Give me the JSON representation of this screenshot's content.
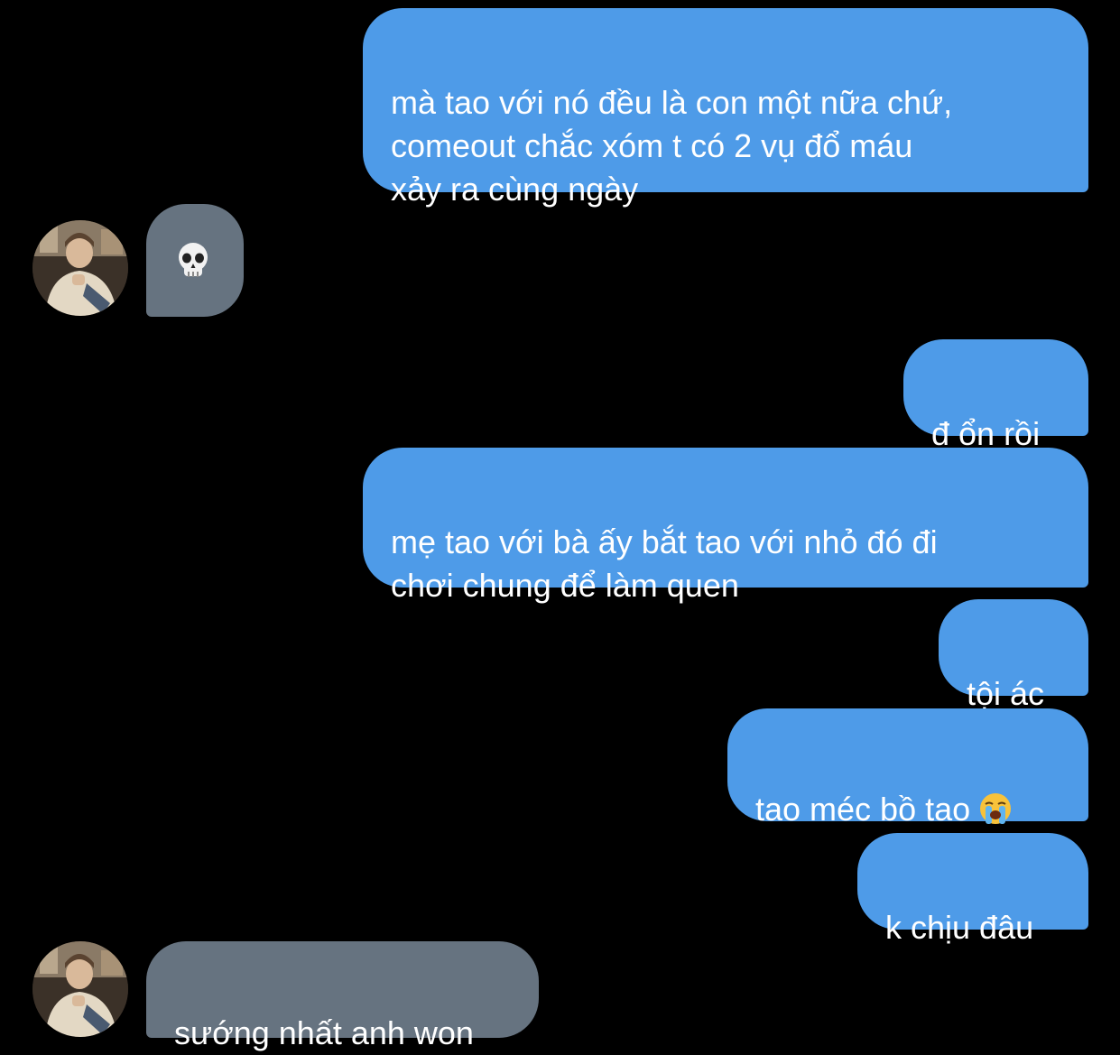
{
  "conversation": {
    "messages": [
      {
        "sender": "me",
        "text": "mà tao với nó đều là con một nữa chứ,\ncomeout chắc xóm t có 2 vụ đổ máu\nxảy ra cùng ngày"
      },
      {
        "sender": "them",
        "emoji": "skull-emoji"
      },
      {
        "sender": "me",
        "text": "đ ổn rồi"
      },
      {
        "sender": "me",
        "text": "mẹ tao với bà ấy bắt tao với nhỏ đó đi\nchơi chung để làm quen"
      },
      {
        "sender": "me",
        "text": "tội ác"
      },
      {
        "sender": "me",
        "text": "tao méc bồ tao",
        "emoji": "loudly-crying-face-emoji"
      },
      {
        "sender": "me",
        "text": "k chịu đâu"
      },
      {
        "sender": "them",
        "text": "sướng nhất anh won"
      }
    ]
  },
  "colors": {
    "background": "#000000",
    "outgoing_bubble": "#4e9be8",
    "incoming_bubble": "#667380",
    "text": "#ffffff"
  }
}
